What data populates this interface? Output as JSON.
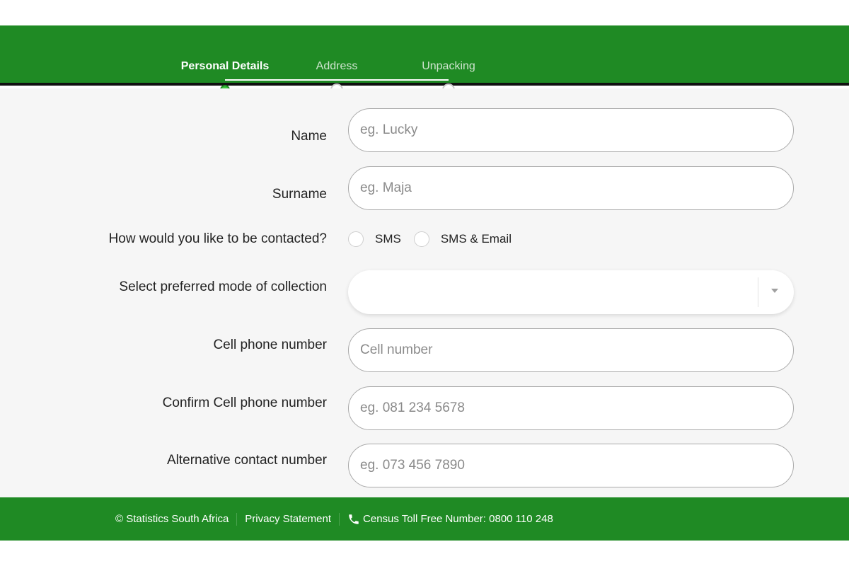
{
  "progress": {
    "steps": [
      {
        "label": "Personal Details",
        "state": "active"
      },
      {
        "label": "Address",
        "state": "pending"
      },
      {
        "label": "Unpacking",
        "state": "pending"
      }
    ]
  },
  "form": {
    "name": {
      "label": "Name",
      "placeholder": "eg. Lucky"
    },
    "surname": {
      "label": "Surname",
      "placeholder": "eg. Maja"
    },
    "contact_method": {
      "label": "How would you like to be contacted?",
      "options": [
        "SMS",
        "SMS & Email"
      ]
    },
    "collection_mode": {
      "label": "Select preferred mode of collection",
      "value": ""
    },
    "cell": {
      "label": "Cell phone number",
      "placeholder": "Cell number"
    },
    "confirm_cell": {
      "label": "Confirm Cell phone number",
      "placeholder": "eg. 081 234 5678"
    },
    "alt_contact": {
      "label": "Alternative contact number",
      "placeholder": "eg. 073 456 7890"
    }
  },
  "footer": {
    "copyright": "© Statistics South Africa",
    "privacy": "Privacy Statement",
    "phone_icon": "phone-icon",
    "toll_free": "Census Toll Free Number: 0800 110 248"
  },
  "colors": {
    "brand_green": "#1f8a24",
    "active_dot": "#3cc83f",
    "background": "#f6f6f6"
  }
}
